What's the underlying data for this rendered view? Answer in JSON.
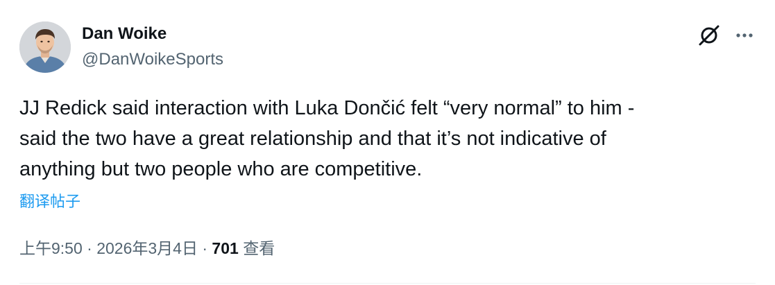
{
  "author": {
    "display_name": "Dan Woike",
    "handle": "@DanWoikeSports"
  },
  "tweet": {
    "text": "JJ Redick said interaction with Luka Dončić felt “very normal” to him -\nsaid the two have a great relationship and that it’s not indicative of\nanything but two people who are competitive.",
    "translate_label": "翻译帖子"
  },
  "meta": {
    "time": "上午9:50",
    "separator": "·",
    "date": "2026年3月4日",
    "views_count": "701",
    "views_label": "查看"
  },
  "icons": {
    "grok": "grok-icon",
    "more": "more-dots-icon"
  },
  "colors": {
    "text_primary": "#0f1419",
    "text_secondary": "#536471",
    "link": "#1d9bf0",
    "divider": "#eff3f4"
  }
}
